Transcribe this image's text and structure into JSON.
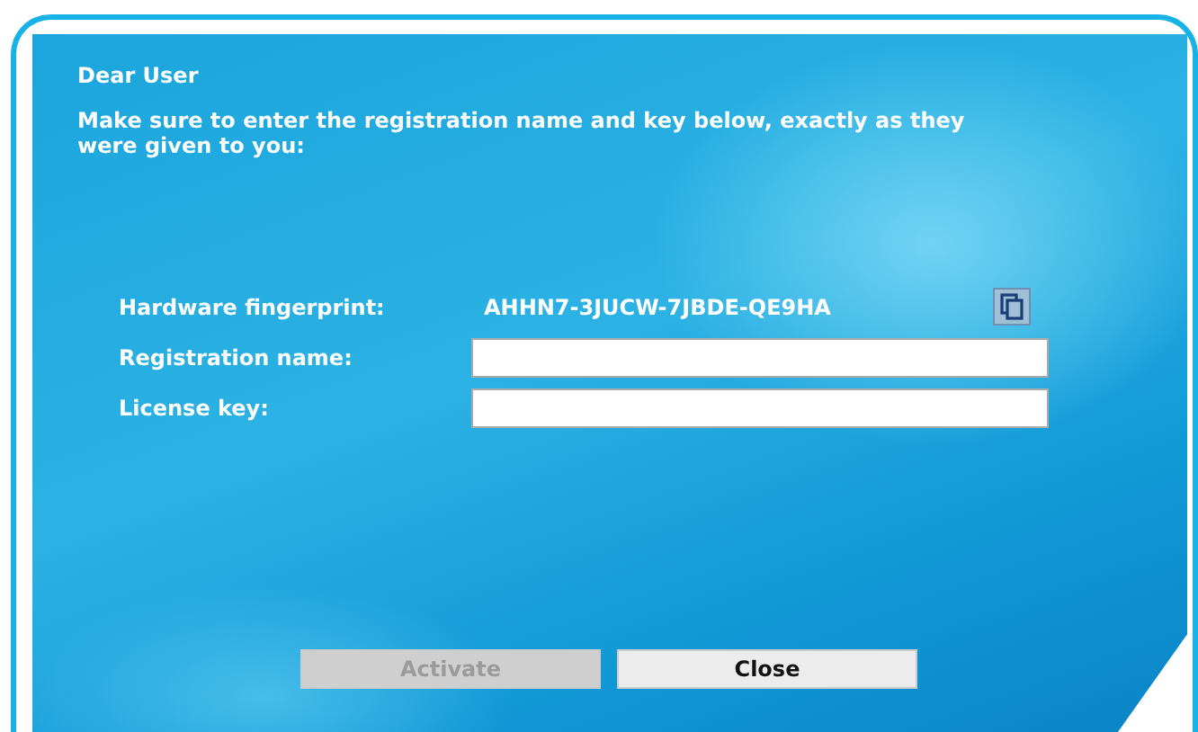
{
  "greeting": "Dear User",
  "instructions": "Make sure to enter the registration name and key below, exactly as they were given to you:",
  "fields": [
    {
      "kind": "readonly",
      "label": "Hardware fingerprint:",
      "value": "AHHN7-3JUCW-7JBDE-QE9HA"
    },
    {
      "kind": "input",
      "label": "Registration name:"
    },
    {
      "kind": "input",
      "label": "License key:"
    }
  ],
  "buttons": [
    {
      "label": "Activate",
      "disabled": true
    },
    {
      "label": "Close",
      "disabled": false
    }
  ]
}
